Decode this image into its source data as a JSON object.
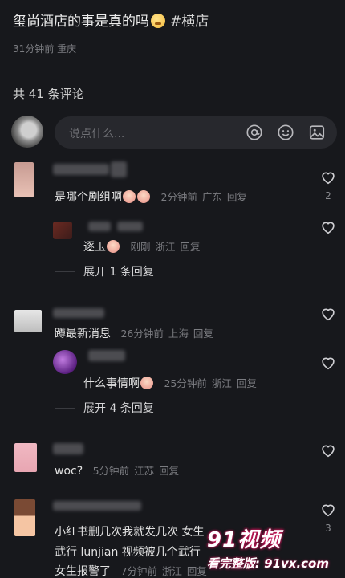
{
  "post": {
    "title": "玺尚酒店的事是真的吗",
    "hashtag": "#横店",
    "time": "31分钟前",
    "location": "重庆"
  },
  "comments_header": "共 41 条评论",
  "input": {
    "placeholder": "说点什么..."
  },
  "comments": [
    {
      "text": "是哪个剧组啊",
      "time": "2分钟前",
      "location": "广东",
      "reply": "回复",
      "likes": "2"
    },
    {
      "text": "逐玉",
      "time": "刚刚",
      "location": "浙江",
      "reply": "回复",
      "likes": ""
    },
    {
      "text": "蹲最新消息",
      "time": "26分钟前",
      "location": "上海",
      "reply": "回复",
      "likes": ""
    },
    {
      "text": "什么事情啊",
      "time": "25分钟前",
      "location": "浙江",
      "reply": "回复",
      "likes": ""
    },
    {
      "text": "woc?",
      "time": "5分钟前",
      "location": "江苏",
      "reply": "回复",
      "likes": ""
    },
    {
      "text": "小红书删几次我就发几次 女生",
      "text2": "武行 lunjian 视频被几个武行",
      "text3": "女生报警了",
      "time": "7分钟前",
      "location": "浙江",
      "reply": "回复",
      "likes": "3"
    }
  ],
  "expand": [
    "展开 1 条回复",
    "展开 4 条回复"
  ],
  "watermark": {
    "top": "91视频",
    "bottom": "看完整版: 91vx.com"
  }
}
